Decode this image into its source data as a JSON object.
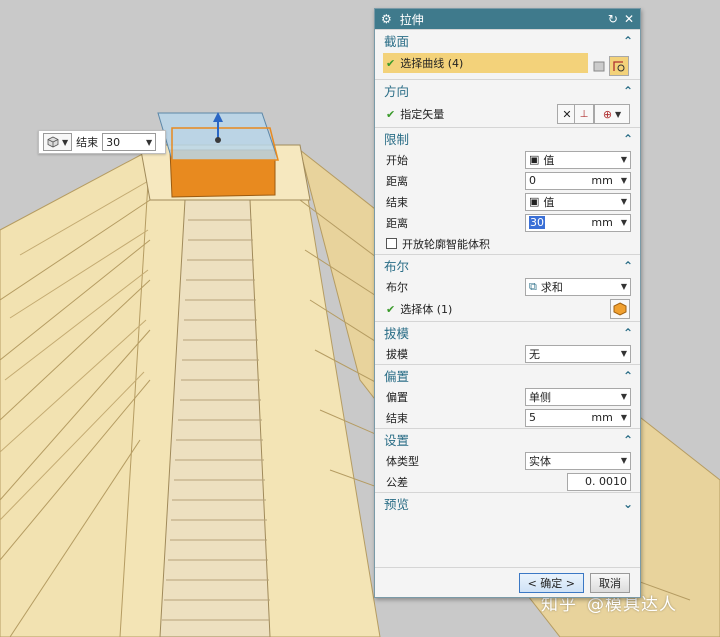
{
  "mini_toolbar": {
    "end_label": "结束",
    "end_value": "30"
  },
  "dialog": {
    "title": "拉伸",
    "sections": {
      "section": {
        "title": "截面",
        "select_curve": "选择曲线 (4)"
      },
      "direction": {
        "title": "方向",
        "specify_vector": "指定矢量"
      },
      "limits": {
        "title": "限制",
        "start_label": "开始",
        "start_value": "值",
        "start_dist_label": "距离",
        "start_dist_value": "0",
        "start_unit": "mm",
        "end_label": "结束",
        "end_value": "值",
        "end_dist_label": "距离",
        "end_dist_value": "30",
        "end_unit": "mm",
        "open_profile": "开放轮廓智能体积"
      },
      "boolean": {
        "title": "布尔",
        "bool_label": "布尔",
        "bool_value": "求和",
        "select_body": "选择体 (1)"
      },
      "draft": {
        "title": "拔模",
        "draft_label": "拔模",
        "draft_value": "无"
      },
      "offset": {
        "title": "偏置",
        "offset_label": "偏置",
        "offset_value": "单侧",
        "end_label": "结束",
        "end_value": "5",
        "end_unit": "mm"
      },
      "settings": {
        "title": "设置",
        "body_type_label": "体类型",
        "body_type_value": "实体",
        "tolerance_label": "公差",
        "tolerance_value": "0. 0010"
      },
      "preview": {
        "title": "预览"
      }
    },
    "ok_label": "< 确定 >",
    "cancel_label": "取消"
  },
  "watermark": {
    "site": "知乎",
    "author": "@模具达人"
  },
  "colors": {
    "titlebar": "#3f7a8c",
    "section_title": "#2b6e87",
    "highlight": "#f3d27a",
    "pyramid": "#f0dfab",
    "extrude_block": "#e88a1f"
  }
}
